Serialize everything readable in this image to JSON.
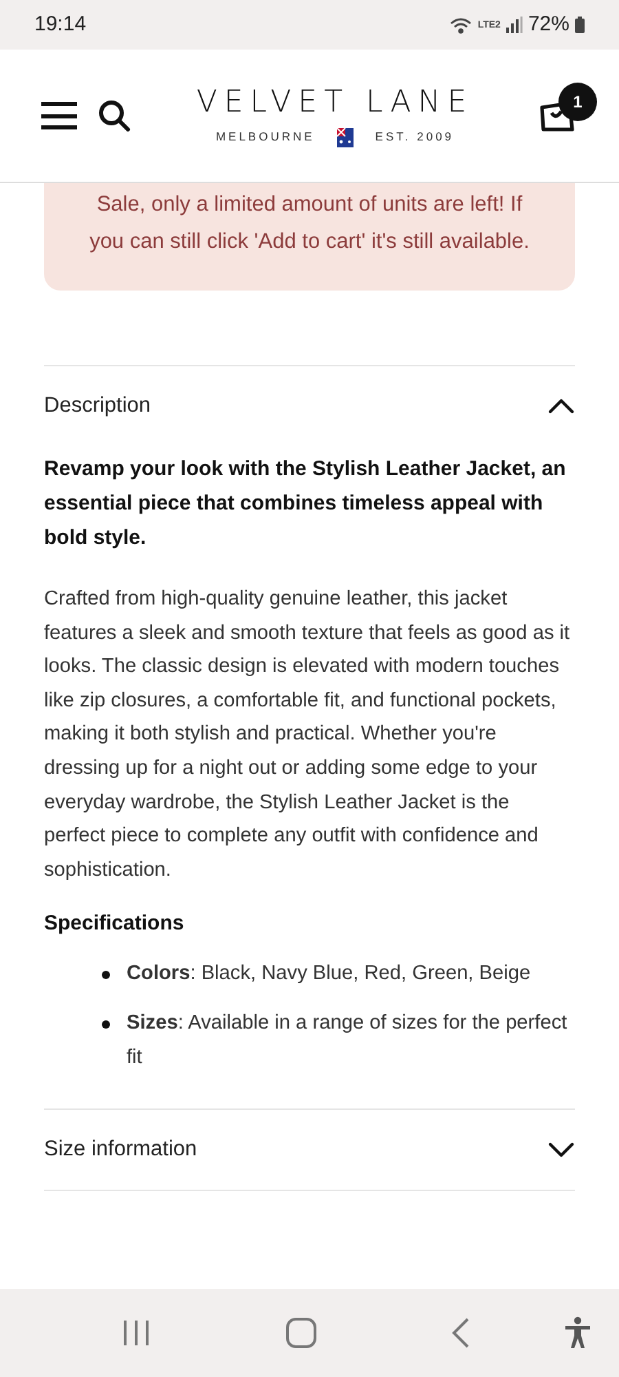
{
  "status_bar": {
    "time": "19:14",
    "network": "LTE2",
    "battery": "72%"
  },
  "header": {
    "brand": "VELVET LANE",
    "location": "MELBOURNE",
    "established": "EST. 2009",
    "cart_count": "1"
  },
  "notice": {
    "text": "Sale, only a limited amount of units are left! If you can still click 'Add to cart' it's still available."
  },
  "accordions": [
    {
      "title": "Description",
      "expanded": true,
      "intro": "Revamp your look with the Stylish Leather Jacket, an essential piece that combines timeless appeal with bold style.",
      "body": "Crafted from high-quality genuine leather, this jacket features a sleek and smooth texture that feels as good as it looks. The classic design is elevated with modern touches like zip closures, a comfortable fit, and functional pockets, making it both stylish and practical. Whether you're dressing up for a night out or adding some edge to your everyday wardrobe, the Stylish Leather Jacket is the perfect piece to complete any outfit with confidence and sophistication.",
      "specs_title": "Specifications",
      "specs": [
        "**Colors**: Black, Navy Blue, Red, Green, Beige",
        "**Sizes**: Available in a range of sizes for the perfect fit"
      ]
    },
    {
      "title": "Size information",
      "expanded": false
    }
  ]
}
